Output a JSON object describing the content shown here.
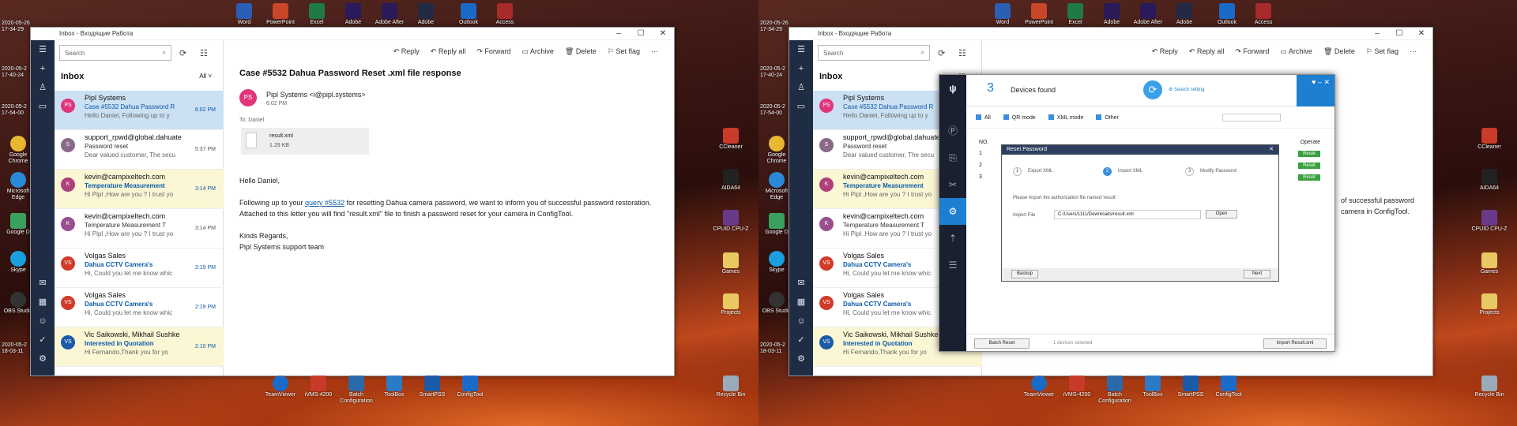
{
  "left": {
    "timestamps": [
      "2020-05-26\n17-34-29",
      "2020-05-2\n17-40-24",
      "2020-05-2\n17-54-00",
      "2020-05-2\n18-03-11"
    ],
    "top_icons": [
      "Word",
      "PowerPoint",
      "Excel",
      "Adobe",
      "Adobe After",
      "Adobe",
      "Outlook",
      "Access"
    ],
    "left_icons": [
      "Google Chrome",
      "Microsoft Edge",
      "Google D",
      "Skype",
      "OBS Studio"
    ],
    "right_icons": [
      "CCleaner",
      "AIDA64",
      "CPUID CPU-Z",
      "Games",
      "Projects",
      "Recycle Bin"
    ],
    "taskbar_icons": [
      "TeamViewer",
      "iVMS-4200",
      "Batch Configuration",
      "ToolBox",
      "SmartPSS",
      "ConfigTool"
    ]
  },
  "mail": {
    "window_title": "Inbox - Входящие Работа",
    "search_placeholder": "Search",
    "folder": "Inbox",
    "filter": "All",
    "toolbar": {
      "reply": "Reply",
      "reply_all": "Reply all",
      "forward": "Forward",
      "archive": "Archive",
      "delete": "Delete",
      "set_flag": "Set flag",
      "more": "···"
    },
    "messages": [
      {
        "initials": "PS",
        "color": "#e0357a",
        "sender": "Pipl Systems",
        "subject": "Case #5532 Dahua Password R",
        "time": "6:02 PM",
        "preview": "Hello Daniel, Following up to y"
      },
      {
        "initials": "S",
        "color": "#8a6a8a",
        "sender": "support_rpwd@global.dahuate",
        "subject": "Password reset",
        "time": "5:37 PM",
        "preview": "Dear valued customer, The secu"
      },
      {
        "initials": "K",
        "color": "#b0407a",
        "sender": "kevin@campixeltech.com",
        "subject": "Temperature Measurement",
        "time": "3:14 PM",
        "preview": "Hi Pipl ,How are you ? I trust yo"
      },
      {
        "initials": "K",
        "color": "#9a5090",
        "sender": "kevin@campixeltech.com",
        "subject": "Temperature Measurement T",
        "time": "3:14 PM",
        "preview": "Hi Pipl ,How are you ? I trust yo"
      },
      {
        "initials": "VS",
        "color": "#d23a2a",
        "sender": "Volgas Sales",
        "subject": "Dahua CCTV Camera's",
        "time": "2:19 PM",
        "preview": "Hi, Could you let me know whic"
      },
      {
        "initials": "VS",
        "color": "#d23a2a",
        "sender": "Volgas Sales",
        "subject": "Dahua CCTV Camera's",
        "time": "2:19 PM",
        "preview": "Hi, Could you let me know whic"
      },
      {
        "initials": "VS",
        "color": "#1a5aa8",
        "sender": "Vic Saikowski, Mikhail Sushke",
        "subject": "Interested in Quotation",
        "time": "2:10 PM",
        "preview": "Hi Fernando,Thank you for yo"
      }
    ],
    "reading": {
      "subject": "Case #5532 Dahua Password Reset .xml file response",
      "sender": "Pipl Systems <i@pipl.systems>",
      "date": "6:02 PM",
      "to": "To: Daniel",
      "attachment_name": "result.xml",
      "attachment_size": "1.29 KB",
      "greeting": "Hello Daniel,",
      "p1_pre": "Following up to your ",
      "p1_link": "query #5532",
      "p1_post": " for resetting Dahua camera password, we want to inform you of successful password restoration. Attached to this letter you will find \"result.xml\" file to finish a password reset for your camera in ConfigTool.",
      "sign1": "Kinds Regards,",
      "sign2": "Pipl Systems support team"
    }
  },
  "configtool": {
    "count": "3",
    "found_label": "Devices found",
    "search_setting": "Search setting",
    "filters": [
      "All",
      "QR mode",
      "XML mode",
      "Other"
    ],
    "col_no": "NO.",
    "col_operate": "Operate",
    "rows": [
      "1",
      "2",
      "3"
    ],
    "op_label": "Reset",
    "batch_reset": "Batch Reset",
    "selected": "1 devices selected",
    "import_result": "Import Result.xml",
    "dialog": {
      "title": "Reset Password",
      "steps": [
        "Export XML",
        "Import XML",
        "Modify Password"
      ],
      "hint": "Please import the authorization file named 'result'",
      "file_label": "Import File",
      "file_path": "C:/Users/1111/Downloads/result.xml",
      "open": "Open",
      "backup": "Backup",
      "next": "Next"
    },
    "right_text1": "of successful password",
    "right_text2": "camera in ConfigTool."
  }
}
